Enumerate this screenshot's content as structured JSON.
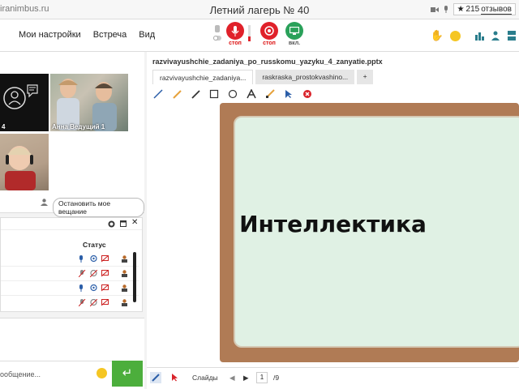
{
  "topbar": {
    "site": "iranimbus.ru",
    "room_title": "Летний лагерь № 40",
    "reviews_count": "215",
    "reviews_word": "отзывов",
    "star": "★"
  },
  "menu": {
    "items": [
      "Мои настройки",
      "Встреча",
      "Вид"
    ]
  },
  "controls": {
    "mic_label": "стоп",
    "cam_label": "стоп",
    "screen_label": "вкл."
  },
  "video": {
    "tile1_label": "4",
    "tile2_label": "Анна  Ведущий  1",
    "stop_broadcast": "Остановить мое вещание"
  },
  "users": {
    "status_header": "Статус"
  },
  "chat": {
    "placeholder": "ообщение...",
    "send_icon": "↵"
  },
  "main": {
    "file_title": "razvivayushchie_zadaniya_po_russkomu_yazyku_4_zanyatie.pptx",
    "tabs": [
      "razvivayushchie_zadaniya...",
      "raskraska_prostokvashino...",
      "+"
    ],
    "slide_text": "Интеллектика",
    "slides_label": "Слайды",
    "page_current": "1",
    "page_total": "/9"
  },
  "colors": {
    "accent_red": "#e0212a",
    "accent_green": "#2aa15a",
    "send_green": "#4cae3c",
    "board_brown": "#b07b55",
    "slide_bg": "#e0f1e4"
  }
}
